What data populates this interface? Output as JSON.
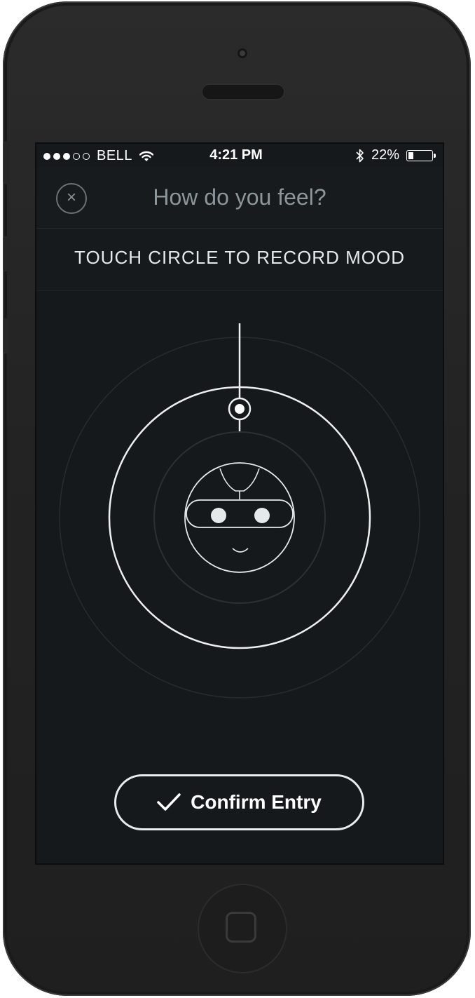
{
  "status_bar": {
    "carrier": "BELL",
    "time": "4:21 PM",
    "battery": "22%",
    "battery_level": 0.22,
    "signal_bars_filled": 3,
    "signal_bars_total": 5
  },
  "header": {
    "title": "How do you feel?",
    "close_icon": "×"
  },
  "instruction": "TOUCH CIRCLE TO RECORD MOOD",
  "confirm_button": {
    "label": "Confirm Entry"
  },
  "colors": {
    "screen_bg": "#15191b",
    "title_gray": "#8d979b",
    "accent_white": "#ffffff"
  },
  "icons": {
    "close": "close-icon",
    "confirm": "checkmark-icon",
    "mood_face": "robot-face-icon",
    "wifi": "wifi-icon",
    "bluetooth": "bluetooth-icon",
    "battery": "battery-icon"
  }
}
